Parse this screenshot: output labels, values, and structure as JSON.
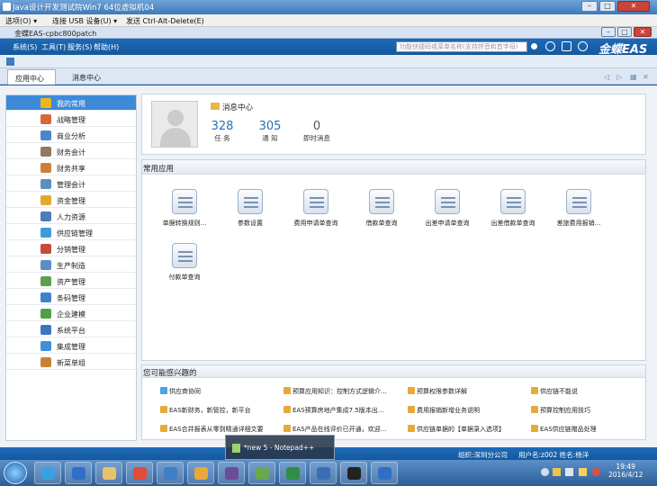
{
  "vm": {
    "title": "Java设计开发测试院Win7 64位虚拟机04",
    "menu": [
      "选项(O) ▾",
      "连接 USB 设备(U) ▾",
      "发送 Ctrl-Alt-Delete(E)"
    ]
  },
  "app": {
    "window_title": "金蝶EAS-cpbc800patch",
    "menu": [
      "系统(S)",
      "工具(T)",
      "服务(S)",
      "帮助(H)"
    ],
    "search_placeholder": "功能快捷码或菜单名称(支持拼音和首字母)",
    "brand": "金蝶EAS"
  },
  "tabs": [
    "应用中心",
    "消息中心"
  ],
  "sidebar": {
    "items": [
      {
        "label": "我的常用",
        "icon": "star-icon",
        "color": "#f2b31b"
      },
      {
        "label": "战略管理",
        "icon": "strategy-icon",
        "color": "#d6673a"
      },
      {
        "label": "商业分析",
        "icon": "chart-icon",
        "color": "#4c86c6"
      },
      {
        "label": "财务会计",
        "icon": "ledger-icon",
        "color": "#8f7a5e"
      },
      {
        "label": "财务共享",
        "icon": "share-icon",
        "color": "#c9813a"
      },
      {
        "label": "管理会计",
        "icon": "book-icon",
        "color": "#5a8fc0"
      },
      {
        "label": "资金管理",
        "icon": "money-icon",
        "color": "#e3a92d"
      },
      {
        "label": "人力资源",
        "icon": "people-icon",
        "color": "#4b7bb8"
      },
      {
        "label": "供应链管理",
        "icon": "supply-icon",
        "color": "#3f9ad8"
      },
      {
        "label": "分销管理",
        "icon": "truck-icon",
        "color": "#c74a3a"
      },
      {
        "label": "生产制造",
        "icon": "gear-icon",
        "color": "#5b8cc6"
      },
      {
        "label": "资产管理",
        "icon": "asset-icon",
        "color": "#5c9f51"
      },
      {
        "label": "条码管理",
        "icon": "barcode-icon",
        "color": "#3d83c9"
      },
      {
        "label": "企业建模",
        "icon": "model-icon",
        "color": "#4ea042"
      },
      {
        "label": "系统平台",
        "icon": "platform-icon",
        "color": "#3a76bf"
      },
      {
        "label": "集成管理",
        "icon": "integration-icon",
        "color": "#3e8fd6"
      },
      {
        "label": "新菜单组",
        "icon": "menu-group-icon",
        "color": "#c9813a"
      }
    ]
  },
  "profile": {
    "section": "消息中心",
    "stats": [
      {
        "value": "328",
        "label": "任 务"
      },
      {
        "value": "305",
        "label": "通 知"
      },
      {
        "value": "0",
        "label": "即时消息"
      }
    ]
  },
  "common_apps": {
    "title": "常用应用",
    "items": [
      "单据转换规则...",
      "参数设置",
      "费用申请单查询",
      "借款单查询",
      "出差申请单查询",
      "出差借款单查询",
      "差旅费用报销...",
      "付款单查询"
    ]
  },
  "interest": {
    "title": "您可能感兴趣的",
    "links": [
      "供应商协同",
      "预算应用知识：控制方式逻辑介...",
      "预算权限参数详解",
      "供应链不能说",
      "EAS新财务，新管控，新平台",
      "EAS预算房地产集成7.5版本出...",
      "费用报销新增业务说明",
      "预算控制应用技巧",
      "EAS合并报表从零到精通详细文要",
      "EAS产品在线评价已开通，欢迎...",
      "供应链单据的【单据录入选项】",
      "EAS供应链赠品处理"
    ]
  },
  "status": {
    "org": "组织:深圳分公司",
    "user": "用户名:z002  姓名:杨洋"
  },
  "taskbar": {
    "popup": "*new  5 - Notepad++",
    "time": "19:49",
    "date": "2016/4/12",
    "apps": [
      "qq-icon",
      "ie-icon",
      "folder-icon",
      "chrome-icon",
      "eclipse-icon",
      "tools-icon",
      "game-icon",
      "chart-app-icon",
      "excel-icon",
      "bim-icon",
      "terminal-icon",
      "eas-icon"
    ]
  }
}
